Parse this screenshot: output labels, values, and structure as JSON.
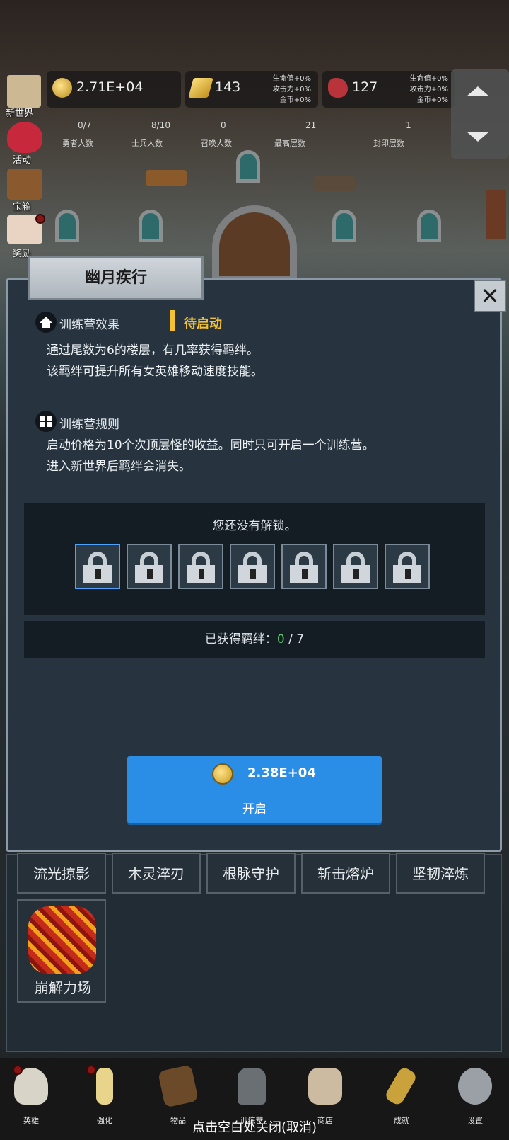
{
  "resources": {
    "gold": "2.71E+04",
    "bars": "143",
    "meat": "127",
    "bonus_lines_1": [
      "生命值+0%",
      "攻击力+0%",
      "金币+0%"
    ],
    "bonus_lines_2": [
      "生命值+0%",
      "攻击力+0%",
      "金币+0%"
    ]
  },
  "stats": [
    {
      "num": "0/7",
      "label": "勇者人数"
    },
    {
      "num": "8/10",
      "label": "士兵人数"
    },
    {
      "num": "0",
      "label": "召唤人数"
    },
    {
      "num": "21",
      "label": "最高层数"
    },
    {
      "num": "1",
      "label": "封印层数"
    }
  ],
  "side_menu": [
    "新世界",
    "活动",
    "宝箱",
    "奖励"
  ],
  "dialog": {
    "title": "幽月疾行",
    "close_glyph": "✕",
    "effect_header": "训练营效果",
    "status": "待启动",
    "effect_lines": [
      "通过尾数为6的楼层，有几率获得羁绊。",
      "该羁绊可提升所有女英雄移动速度技能。"
    ],
    "rules_header": "训练营规则",
    "rules_lines": [
      "启动价格为10个次顶层怪的收益。同时只可开启一个训练营。",
      "进入新世界后羁绊会消失。"
    ],
    "locked_message": "您还没有解锁。",
    "lock_count": 7,
    "bonds_label": "已获得羁绊：",
    "bonds_current": "0",
    "bonds_total": "/ 7",
    "cost": "2.38E+04",
    "open_label": "开启"
  },
  "skills": [
    "流光掠影",
    "木灵淬刃",
    "根脉守护",
    "斩击熔炉",
    "坚韧淬炼",
    "崩解力场"
  ],
  "nav": [
    "英雄",
    "强化",
    "物品",
    "训练营",
    "商店",
    "成就",
    "设置"
  ],
  "close_hint": "点击空白处关闭(取消)",
  "colors": {
    "accent_blue": "#2b8ee6",
    "status_yellow": "#f2c233",
    "bond_green": "#5ec46b",
    "dialog_bg": "#27343f"
  }
}
